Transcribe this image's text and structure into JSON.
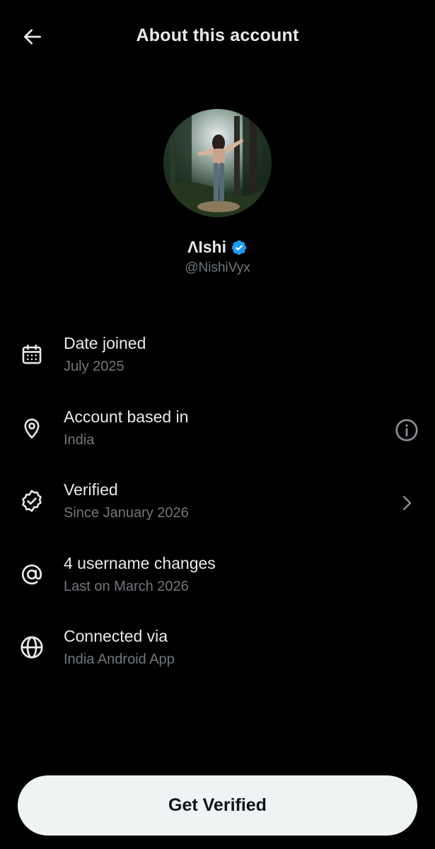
{
  "header": {
    "title": "About this account",
    "back_icon": "arrow-left-icon"
  },
  "profile": {
    "display_name": "ɅIshi",
    "handle": "@NishiVyx",
    "verified_color": "#1d9bf0",
    "avatar_icon": "profile-photo"
  },
  "info_items": [
    {
      "icon": "calendar-icon",
      "title": "Date joined",
      "subtitle": "July 2025",
      "action": null
    },
    {
      "icon": "location-pin-icon",
      "title": "Account based in",
      "subtitle": "India",
      "action": "info-icon"
    },
    {
      "icon": "verified-badge-icon",
      "title": "Verified",
      "subtitle": "Since January 2026",
      "action": "chevron-right-icon"
    },
    {
      "icon": "at-sign-icon",
      "title": "4 username changes",
      "subtitle": "Last on March 2026",
      "action": null
    },
    {
      "icon": "globe-icon",
      "title": "Connected via",
      "subtitle": "India Android App",
      "action": null
    }
  ],
  "cta": {
    "label": "Get Verified"
  },
  "colors": {
    "background": "#000000",
    "primary_text": "#e7e9ea",
    "secondary_text": "#71767b",
    "button_bg": "#eff3f4"
  }
}
